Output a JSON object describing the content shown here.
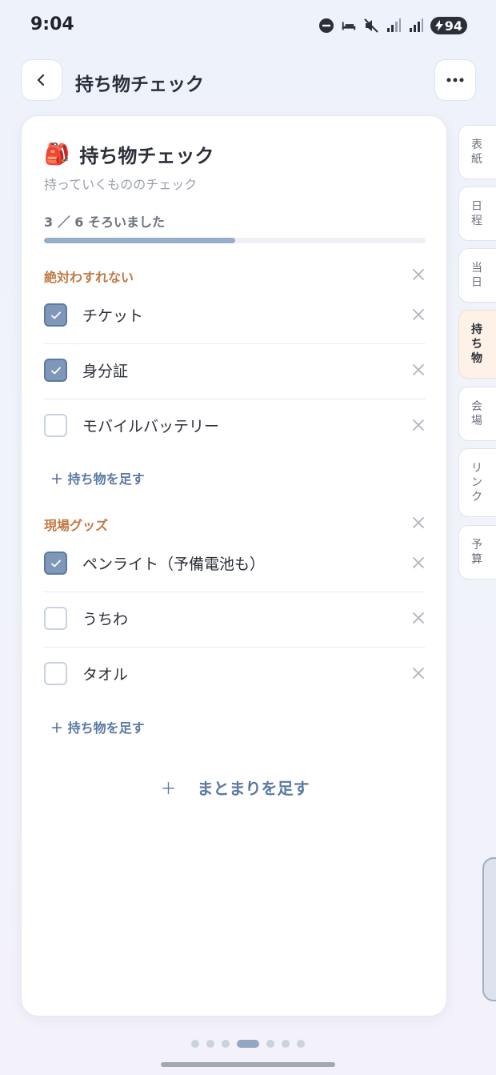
{
  "status": {
    "time": "9:04",
    "battery": "94"
  },
  "header": {
    "title": "持ち物チェック"
  },
  "card": {
    "emoji": "🎒",
    "title": "持ち物チェック",
    "subtitle": "持っていくもののチェック",
    "progress": {
      "text": "3 ／ 6 そろいました",
      "done": 3,
      "total": 6
    }
  },
  "groups": [
    {
      "title": "絶対わすれない",
      "items": [
        {
          "label": "チケット",
          "checked": true
        },
        {
          "label": "身分証",
          "checked": true
        },
        {
          "label": "モバイルバッテリー",
          "checked": false
        }
      ],
      "add_label": "＋ 持ち物を足す"
    },
    {
      "title": "現場グッズ",
      "items": [
        {
          "label": "ペンライト（予備電池も）",
          "checked": true
        },
        {
          "label": "うちわ",
          "checked": false
        },
        {
          "label": "タオル",
          "checked": false
        }
      ],
      "add_label": "＋ 持ち物を足す"
    }
  ],
  "add_group": {
    "plus": "＋",
    "label": "まとまりを足す"
  },
  "side_tabs": [
    {
      "label": "表紙",
      "active": false
    },
    {
      "label": "日程",
      "active": false
    },
    {
      "label": "当日",
      "active": false
    },
    {
      "label": "持ち物",
      "active": true
    },
    {
      "label": "会場",
      "active": false
    },
    {
      "label": "リンク",
      "active": false
    },
    {
      "label": "予算",
      "active": false
    }
  ],
  "pager": {
    "count": 7,
    "active": 3
  },
  "colors": {
    "accent": "#5b7aa3",
    "check": "#7f97b9",
    "section": "#c07a44",
    "active_tab": "#fdf1e8"
  }
}
